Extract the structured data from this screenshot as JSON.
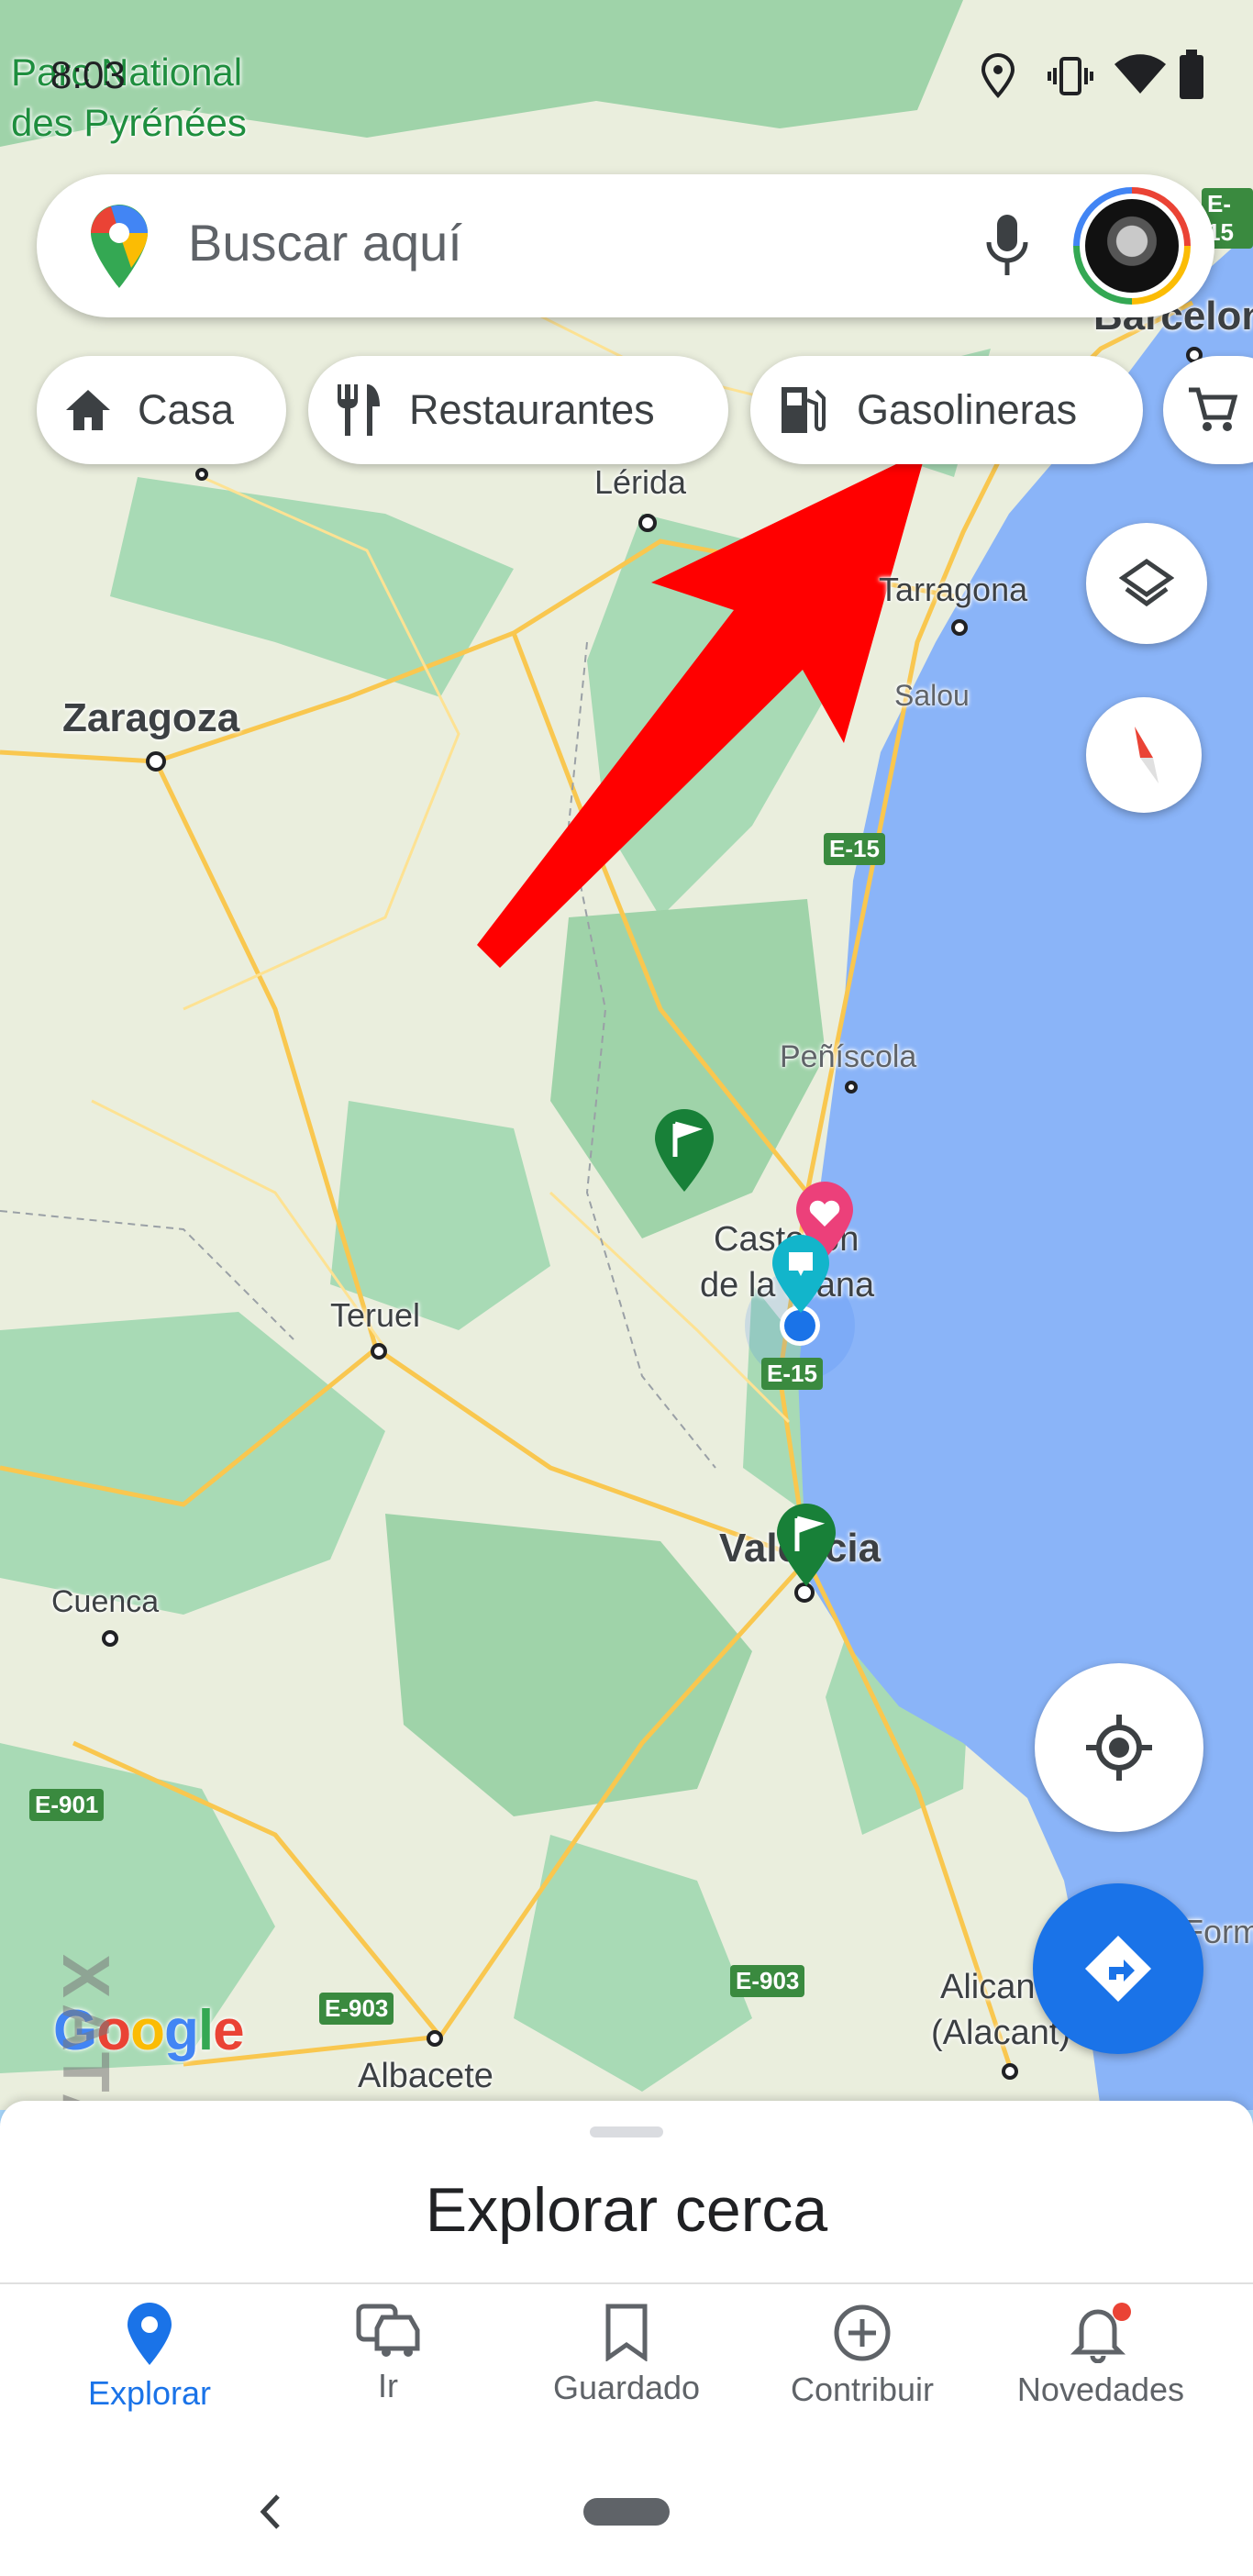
{
  "status_bar": {
    "time": "8:03"
  },
  "search": {
    "placeholder": "Buscar aquí"
  },
  "chips": [
    {
      "label": "Casa",
      "icon": "home-icon"
    },
    {
      "label": "Restaurantes",
      "icon": "restaurant-icon"
    },
    {
      "label": "Gasolineras",
      "icon": "gas-station-icon"
    },
    {
      "label": "",
      "icon": "shopping-cart-icon"
    }
  ],
  "map": {
    "labels": {
      "park": "Parc National",
      "park2": "des Pyrénées",
      "barcelona": "Barcelon",
      "lerida": "Lérida",
      "tarragona": "Tarragona",
      "salou": "Salou",
      "zaragoza": "Zaragoza",
      "peniscola": "Peñíscola",
      "castellon1": "Castellon",
      "castellon2": "de la Plana",
      "teruel": "Teruel",
      "valencia": "Valencia",
      "cuenca": "Cuenca",
      "alicante1": "Alicante",
      "alicante2": "(Alacant)",
      "albacete": "Albacete",
      "formentera": "Form"
    },
    "shields": {
      "e15_top": "E-15",
      "e15_mid": "E-15",
      "e15_low": "E-15",
      "e901": "E-901",
      "e903_left": "E-903",
      "e903_right": "E-903"
    },
    "watermark": "XATAKA BASICS",
    "logo": "Google"
  },
  "bottom_sheet": {
    "title": "Explorar cerca"
  },
  "nav": [
    {
      "label": "Explorar",
      "icon": "explore-pin-icon",
      "active": true
    },
    {
      "label": "Ir",
      "icon": "commute-icon",
      "active": false
    },
    {
      "label": "Guardado",
      "icon": "bookmark-icon",
      "active": false
    },
    {
      "label": "Contribuir",
      "icon": "add-circle-icon",
      "active": false
    },
    {
      "label": "Novedades",
      "icon": "bell-icon",
      "active": false
    }
  ],
  "colors": {
    "accent": "#1a73e8",
    "arrow": "#ff0000",
    "land": "#eef2e1",
    "forest": "#a8dab5",
    "water": "#8ab4f8",
    "road": "#f9c74f"
  }
}
